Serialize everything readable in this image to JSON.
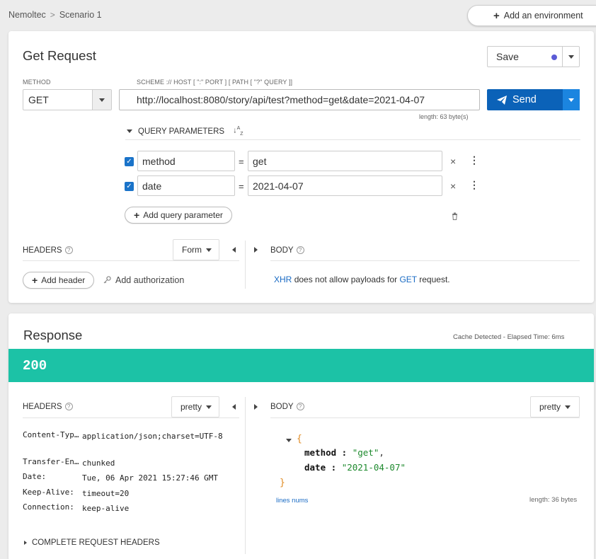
{
  "breadcrumb": {
    "project": "Nemoltec",
    "scenario": "Scenario 1"
  },
  "add_environment_label": "Add an environment",
  "request": {
    "title": "Get Request",
    "save_label": "Save",
    "method_label": "METHOD",
    "method_value": "GET",
    "url_label": "SCHEME :// HOST [ \":\" PORT ] [ PATH [ \"?\" QUERY ]]",
    "url_value": "http://localhost:8080/story/api/test?method=get&date=2021-04-07",
    "url_length": "length: 63 byte(s)",
    "send_label": "Send",
    "query_params_title": "QUERY PARAMETERS",
    "params": [
      {
        "name": "method",
        "value": "get",
        "checked": true
      },
      {
        "name": "date",
        "value": "2021-04-07",
        "checked": true
      }
    ],
    "add_param_label": "Add query parameter",
    "headers_title": "HEADERS",
    "headers_mode": "Form",
    "add_header_label": "Add header",
    "add_auth_label": "Add authorization",
    "body_title": "BODY",
    "body_note": {
      "xhr": "XHR",
      "middle": "does not allow payloads for",
      "get": "GET",
      "end": "request."
    }
  },
  "response": {
    "title": "Response",
    "meta": "Cache Detected - Elapsed Time: 6ms",
    "status": "200",
    "headers_title": "HEADERS",
    "headers_mode": "pretty",
    "body_title": "BODY",
    "body_mode": "pretty",
    "headers": [
      {
        "key": "Content-Typ…",
        "value": "application/json;charset=UTF-8"
      },
      {
        "key": "Transfer-En…",
        "value": "chunked"
      },
      {
        "key": "Date:",
        "value": "Tue, 06 Apr 2021 15:27:46 GMT"
      },
      {
        "key": "Keep-Alive:",
        "value": "timeout=20"
      },
      {
        "key": "Connection:",
        "value": "keep-alive"
      }
    ],
    "complete_headers_label": "COMPLETE REQUEST HEADERS",
    "json": [
      {
        "key": "method",
        "value": "\"get\"",
        "comma": ","
      },
      {
        "key": "date",
        "value": "\"2021-04-07\"",
        "comma": ""
      }
    ],
    "lines_nums": "lines nums",
    "body_length": "length: 36 bytes"
  },
  "colors": {
    "accent": "#0b62b8",
    "status_ok": "#1cc2a6"
  }
}
